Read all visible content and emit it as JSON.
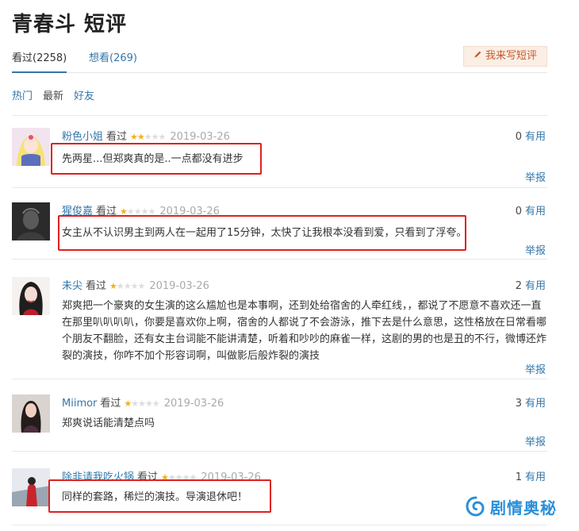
{
  "page": {
    "title": "青春斗 短评"
  },
  "tabs": {
    "seen": "看过(2258)",
    "want": "想看(269)"
  },
  "write_button": {
    "label": "我来写短评"
  },
  "filters": {
    "hot": "热门",
    "newest": "最新",
    "friends": "好友"
  },
  "rating_colors": {
    "on": "#f4b01e",
    "off": "#dddddd"
  },
  "comments": [
    {
      "user": "粉色小姐",
      "status": "看过",
      "stars": 2,
      "date": "2019-03-26",
      "votes": "0",
      "useful": "有用",
      "text": "先两星...但郑爽真的是..一点都没有进步",
      "report": "举报",
      "highlighted": true
    },
    {
      "user": "猩俊嘉",
      "status": "看过",
      "stars": 1,
      "date": "2019-03-26",
      "votes": "0",
      "useful": "有用",
      "text": "女主从不认识男主到两人在一起用了15分钟，太快了让我根本没看到爱，只看到了浮夸。",
      "report": "举报",
      "highlighted": true
    },
    {
      "user": "未尖",
      "status": "看过",
      "stars": 1,
      "date": "2019-03-26",
      "votes": "2",
      "useful": "有用",
      "text": "郑爽把一个豪爽的女生演的这么尴尬也是本事啊，还到处给宿舍的人牵红线，，都说了不愿意不喜欢还一直在那里叭叭叭叭，你要是喜欢你上啊，宿舍的人都说了不会游泳，推下去是什么意思，这性格放在日常看哪个朋友不翻脸，还有女主台词能不能讲清楚，听着和吵吵的麻雀一样，这剧的男的也是丑的不行，微博还炸裂的演技，你咋不加个形容词啊，叫做影后般炸裂的演技",
      "report": "举报",
      "highlighted": false
    },
    {
      "user": "Miimor",
      "status": "看过",
      "stars": 1,
      "date": "2019-03-26",
      "votes": "3",
      "useful": "有用",
      "text": "郑爽说话能清楚点吗",
      "report": "举报",
      "highlighted": false
    },
    {
      "user": "除非请我吃火锅",
      "status": "看过",
      "stars": 1,
      "date": "2019-03-26",
      "votes": "1",
      "useful": "有用",
      "text": "同样的套路，稀烂的演技。导演退休吧！",
      "report": "",
      "highlighted": true
    }
  ],
  "watermark": {
    "text": "剧情奥秘",
    "icon": "swirl-icon"
  }
}
